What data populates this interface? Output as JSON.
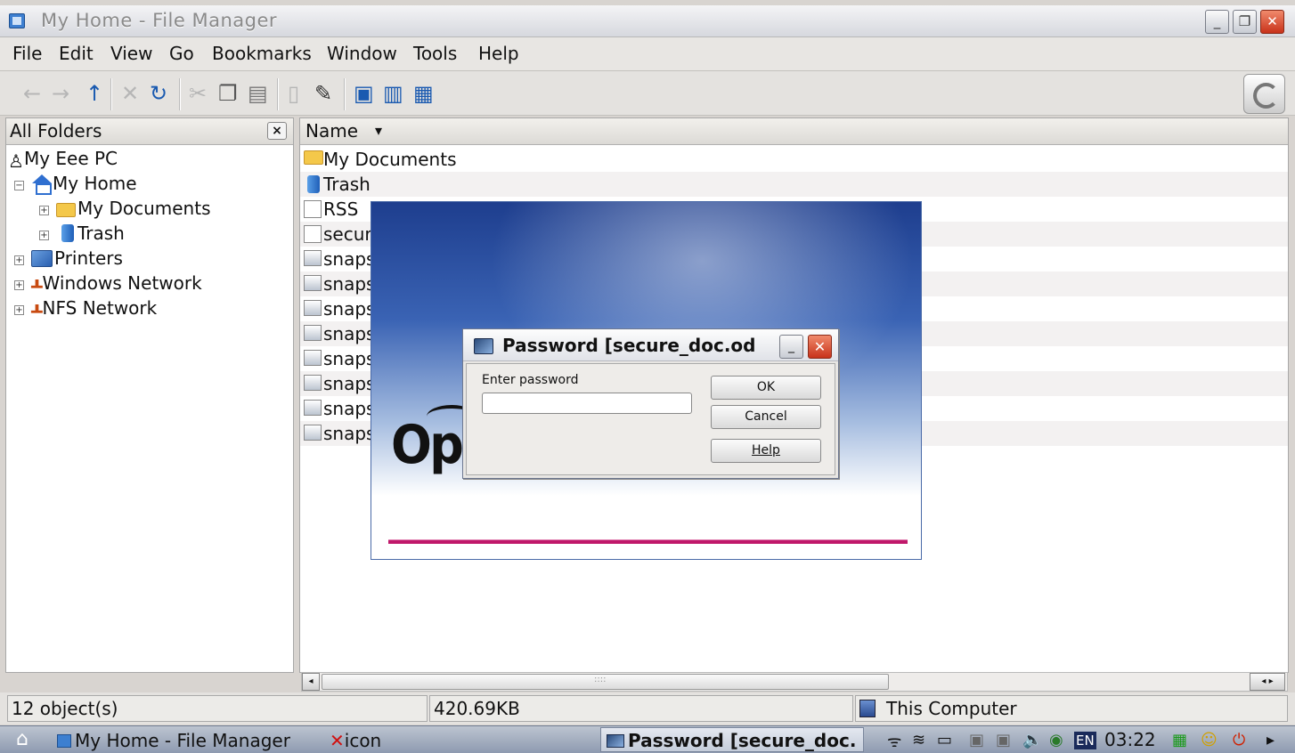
{
  "window": {
    "title": "My Home - File Manager",
    "min": "_",
    "restore": "❐",
    "close": "✕"
  },
  "menu": [
    "File",
    "Edit",
    "View",
    "Go",
    "Bookmarks",
    "Window",
    "Tools",
    "Help"
  ],
  "toolbar": {
    "icons": [
      "back-icon",
      "forward-icon",
      "up-icon",
      "stop-icon",
      "reload-icon",
      "cut-icon",
      "copy-icon",
      "paste-icon",
      "delete-icon",
      "properties-icon",
      "icon-view-icon",
      "detail-view-icon",
      "list-view-icon"
    ]
  },
  "left_panel": {
    "title": "All Folders",
    "close": "×",
    "tree": [
      {
        "label": "My Eee PC",
        "expander": ""
      },
      {
        "label": "My Home",
        "expander": "−"
      },
      {
        "label": "My Documents",
        "expander": "+"
      },
      {
        "label": "Trash",
        "expander": "+"
      },
      {
        "label": "Printers",
        "expander": "+"
      },
      {
        "label": "Windows Network",
        "expander": "+"
      },
      {
        "label": "NFS Network",
        "expander": "+"
      }
    ]
  },
  "file_list": {
    "column_header": "Name",
    "sort_indicator": "▾",
    "rows": [
      "My Documents",
      "Trash",
      "RSS",
      "secur",
      "snaps",
      "snaps",
      "snaps",
      "snaps",
      "snaps",
      "snaps",
      "snaps",
      "snaps"
    ]
  },
  "scrollbar": {
    "left": "◂",
    "right": "◂ ▸",
    "grip": "::::"
  },
  "status": {
    "count": "12 object(s)",
    "size": "420.69KB",
    "location": "This Computer"
  },
  "taskbar": {
    "items": [
      "My Home - File Manager",
      "icon",
      "Password [secure_doc."
    ],
    "clock": "03:22",
    "lang": "EN"
  },
  "splash": {
    "brand_text": "Op"
  },
  "dialog": {
    "title": "Password [secure_doc.od",
    "label": "Enter password",
    "password_value": "",
    "ok": "OK",
    "cancel": "Cancel",
    "help": "Help",
    "min": "_",
    "close": "✕"
  }
}
